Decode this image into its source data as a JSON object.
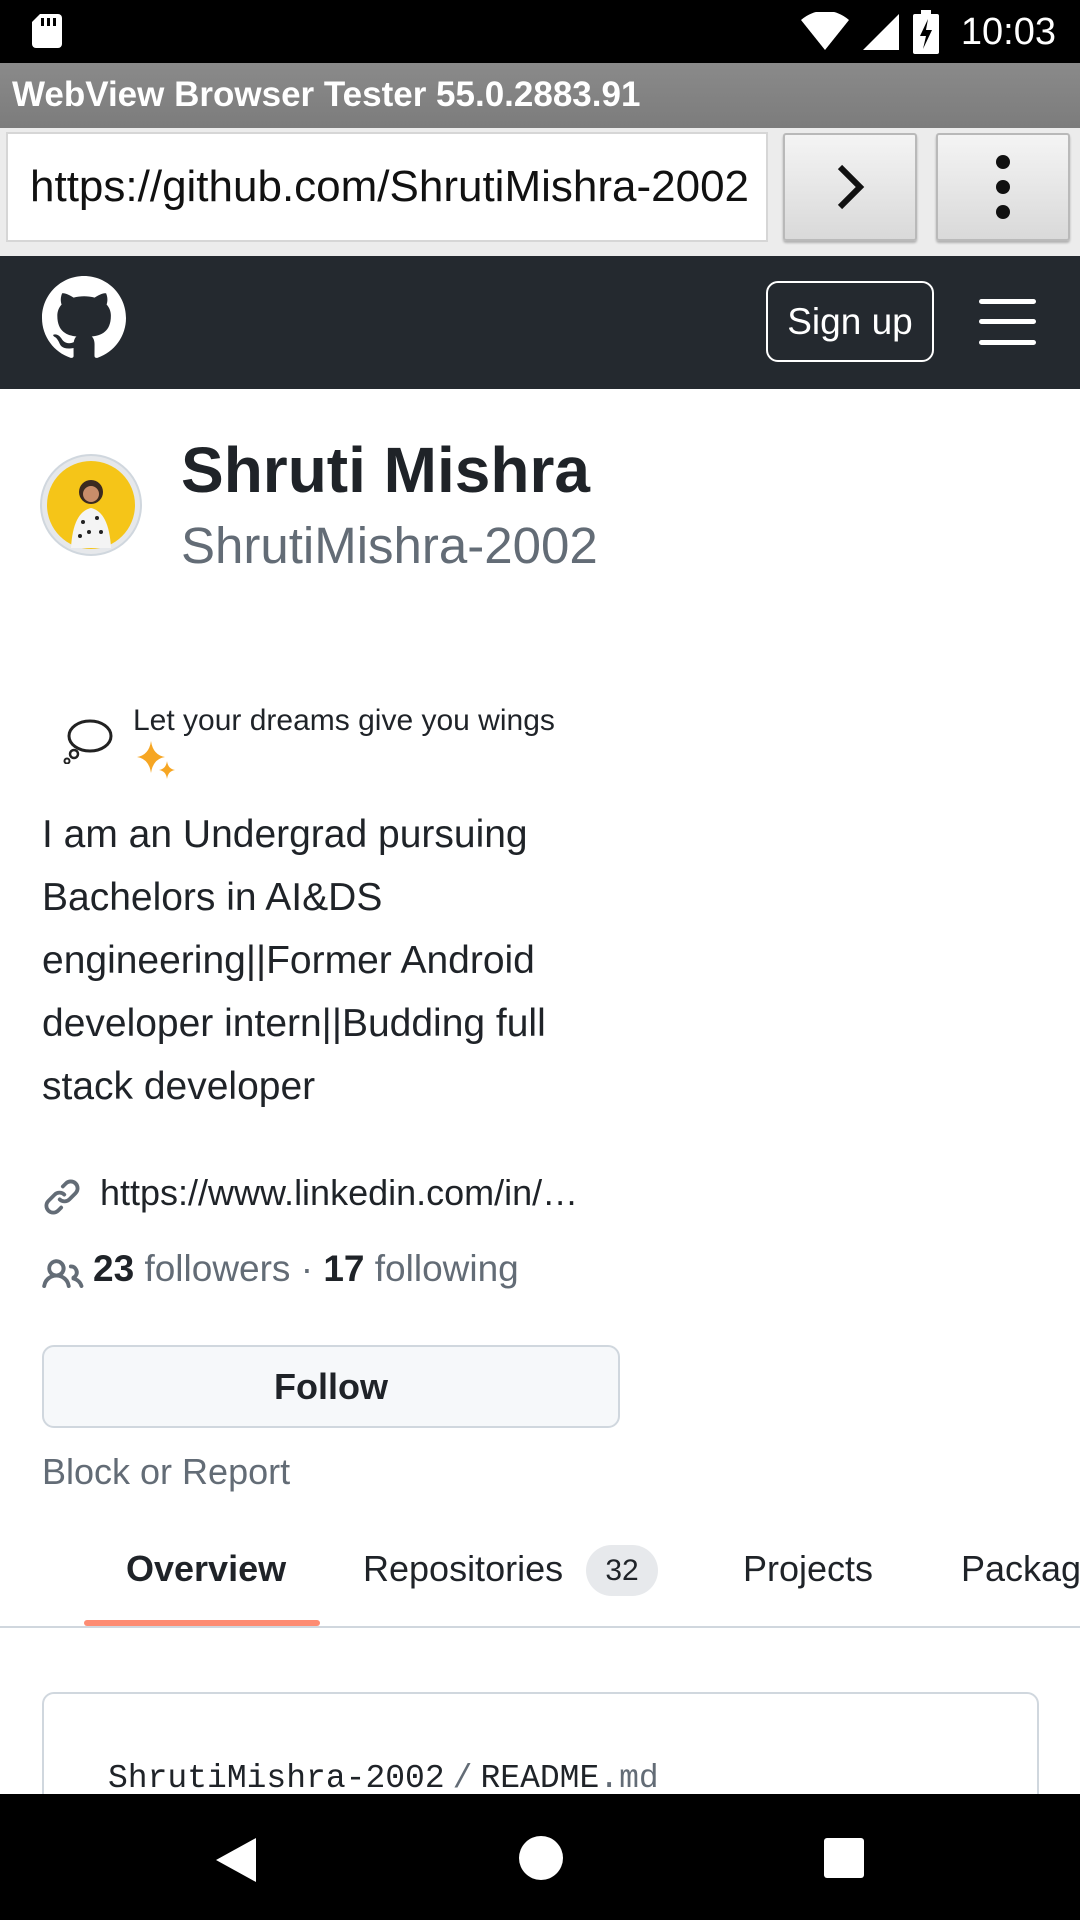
{
  "status_bar": {
    "time": "10:03",
    "icons": [
      "sd-card-icon",
      "wifi-icon",
      "signal-icon",
      "battery-charging-icon"
    ]
  },
  "app": {
    "title": "WebView Browser Tester 55.0.2883.91"
  },
  "url_bar": {
    "value": "https://github.com/ShrutiMishra-2002",
    "go_icon": "chevron-right-icon",
    "menu_icon": "more-vertical-icon"
  },
  "github_header": {
    "logo_icon": "github-octocat-icon",
    "signup_label": "Sign up",
    "menu_icon": "hamburger-menu-icon"
  },
  "profile": {
    "name": "Shruti Mishra",
    "login": "ShrutiMishra-2002",
    "status_text": "Let your dreams give you wings",
    "status_icons": [
      "thought-balloon-icon",
      "sparkles-icon"
    ],
    "bio": "I am an Undergrad pursuing Bachelors in AI&DS engineering||Former Android developer intern||Budding full stack developer",
    "website": "https://www.linkedin.com/in/…",
    "followers_count": "23",
    "followers_label": "followers",
    "separator": "·",
    "following_count": "17",
    "following_label": "following",
    "follow_label": "Follow",
    "block_report_label": "Block or Report"
  },
  "tabs": {
    "overview": "Overview",
    "repositories": "Repositories",
    "repositories_count": "32",
    "projects": "Projects",
    "packages": "Packag",
    "active": "Overview"
  },
  "readme": {
    "owner": "ShrutiMishra-2002",
    "separator": "/",
    "file_base": "README",
    "file_ext": ".md"
  },
  "colors": {
    "github_header_bg": "#24292f",
    "tab_underline": "#fd8c73",
    "muted_text": "#636c76",
    "text": "#1f2328",
    "avatar_bg": "#f5c518"
  }
}
